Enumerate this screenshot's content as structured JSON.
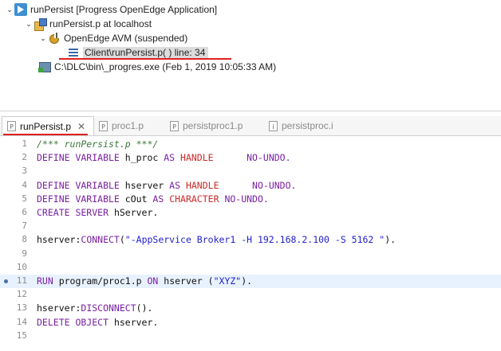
{
  "debug_tree": {
    "launch": {
      "label": "runPersist [Progress OpenEdge Application]"
    },
    "target": {
      "label": "runPersist.p at localhost"
    },
    "avm": {
      "label": "OpenEdge AVM (suspended)"
    },
    "frame": {
      "label": "Client\\runPersist.p(  ) line: 34"
    },
    "process": {
      "label": "C:\\DLC\\bin\\_progres.exe (Feb 1, 2019 10:05:33 AM)"
    }
  },
  "editor_tabs": [
    {
      "label": "runPersist.p",
      "icon": "P",
      "active": true
    },
    {
      "label": "proc1.p",
      "icon": "P",
      "active": false
    },
    {
      "label": "persistproc1.p",
      "icon": "P",
      "active": false
    },
    {
      "label": "persistproc.i",
      "icon": "i",
      "active": false
    }
  ],
  "code": {
    "lines": [
      {
        "num": "1",
        "tokens": [
          [
            "cm",
            "/*** runPersist.p ***/"
          ]
        ]
      },
      {
        "num": "2",
        "tokens": [
          [
            "kw",
            "DEFINE VARIABLE"
          ],
          [
            "id",
            " h_proc "
          ],
          [
            "kw",
            "AS"
          ],
          [
            "ty",
            " HANDLE"
          ],
          [
            "id",
            "      "
          ],
          [
            "kw",
            "NO-UNDO."
          ]
        ]
      },
      {
        "num": "3",
        "tokens": []
      },
      {
        "num": "4",
        "tokens": [
          [
            "kw",
            "DEFINE VARIABLE"
          ],
          [
            "id",
            " hserver "
          ],
          [
            "kw",
            "AS"
          ],
          [
            "ty",
            " HANDLE"
          ],
          [
            "id",
            "      "
          ],
          [
            "kw",
            "NO-UNDO."
          ]
        ]
      },
      {
        "num": "5",
        "tokens": [
          [
            "kw",
            "DEFINE VARIABLE"
          ],
          [
            "id",
            " cOut "
          ],
          [
            "kw",
            "AS"
          ],
          [
            "ty",
            " CHARACTER"
          ],
          [
            "kw",
            " NO-UNDO."
          ]
        ]
      },
      {
        "num": "6",
        "tokens": [
          [
            "kw",
            "CREATE SERVER"
          ],
          [
            "id",
            " hServer."
          ]
        ]
      },
      {
        "num": "7",
        "tokens": []
      },
      {
        "num": "8",
        "tokens": [
          [
            "id",
            "hserver:"
          ],
          [
            "fn",
            "CONNECT"
          ],
          [
            "id",
            "("
          ],
          [
            "str",
            "\"-AppService Broker1 -H 192.168.2.100 -S 5162 \""
          ],
          [
            "id",
            ")."
          ]
        ]
      },
      {
        "num": "9",
        "tokens": []
      },
      {
        "num": "10",
        "tokens": []
      },
      {
        "num": "11",
        "tokens": [
          [
            "kw",
            "RUN"
          ],
          [
            "id",
            " program/proc1.p "
          ],
          [
            "kw",
            "ON"
          ],
          [
            "id",
            " hserver ("
          ],
          [
            "str",
            "\"XYZ\""
          ],
          [
            "id",
            ")."
          ]
        ]
      },
      {
        "num": "12",
        "tokens": []
      },
      {
        "num": "13",
        "tokens": [
          [
            "id",
            "hserver:"
          ],
          [
            "fn",
            "DISCONNECT"
          ],
          [
            "id",
            "()."
          ]
        ]
      },
      {
        "num": "14",
        "tokens": [
          [
            "kw",
            "DELETE OBJECT"
          ],
          [
            "id",
            " hserver."
          ]
        ]
      },
      {
        "num": "15",
        "tokens": []
      }
    ],
    "highlighted_line": "11"
  },
  "colors": {
    "keyword": "#7a1fa2",
    "type": "#cc2a2a",
    "string": "#2020d0",
    "comment": "#3a7a3a",
    "annotation_underline": "#e02020",
    "current_line": "#e8f2ff"
  }
}
